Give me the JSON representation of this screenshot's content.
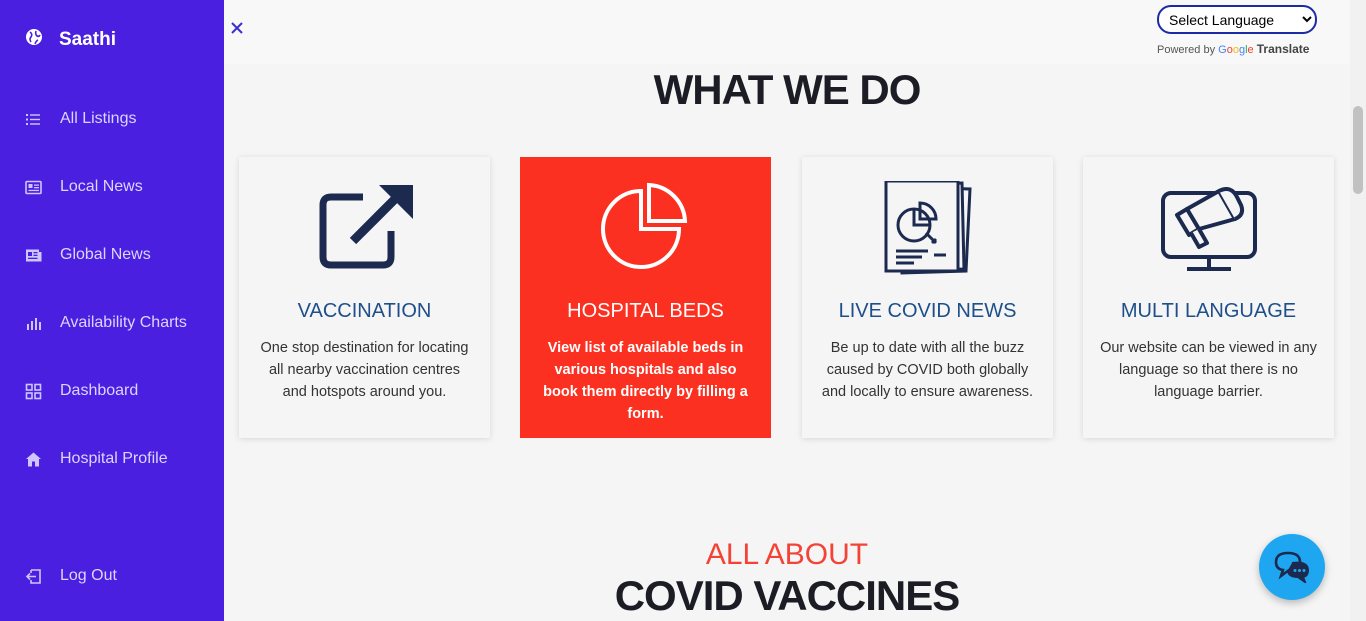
{
  "sidebar": {
    "brand": "Saathi",
    "items": [
      {
        "label": "All Listings",
        "icon": "list-icon"
      },
      {
        "label": "Local News",
        "icon": "newspaper-icon"
      },
      {
        "label": "Global News",
        "icon": "news-feed-icon"
      },
      {
        "label": "Availability Charts",
        "icon": "bar-chart-icon"
      },
      {
        "label": "Dashboard",
        "icon": "dashboard-grid-icon"
      },
      {
        "label": "Hospital Profile",
        "icon": "home-icon"
      }
    ],
    "logout": "Log Out"
  },
  "translate": {
    "selected": "Select Language",
    "powered_by": "Powered by",
    "google": [
      "G",
      "o",
      "o",
      "g",
      "l",
      "e"
    ],
    "translate_label": "Translate"
  },
  "section": {
    "title": "WHAT WE DO"
  },
  "cards": [
    {
      "title": "VACCINATION",
      "text": "One stop destination for locating all nearby vaccination centres and hotspots around you.",
      "icon": "external-link-icon"
    },
    {
      "title": "HOSPITAL BEDS",
      "text": "View list of available beds in various hospitals and also book them directly by filling a form.",
      "icon": "pie-chart-icon"
    },
    {
      "title": "LIVE COVID NEWS",
      "text": "Be up to date with all the buzz caused by COVID both globally and locally to ensure awareness.",
      "icon": "report-document-icon"
    },
    {
      "title": "MULTI LANGUAGE",
      "text": "Our website can be viewed in any language so that there is no language barrier.",
      "icon": "megaphone-monitor-icon"
    }
  ],
  "about": {
    "kicker": "ALL ABOUT",
    "title": "COVID VACCINES"
  },
  "colors": {
    "sidebar": "#4b1fe0",
    "accent_red": "#fc3020",
    "card_title": "#1e4f8a",
    "chat": "#1ea7f0"
  }
}
